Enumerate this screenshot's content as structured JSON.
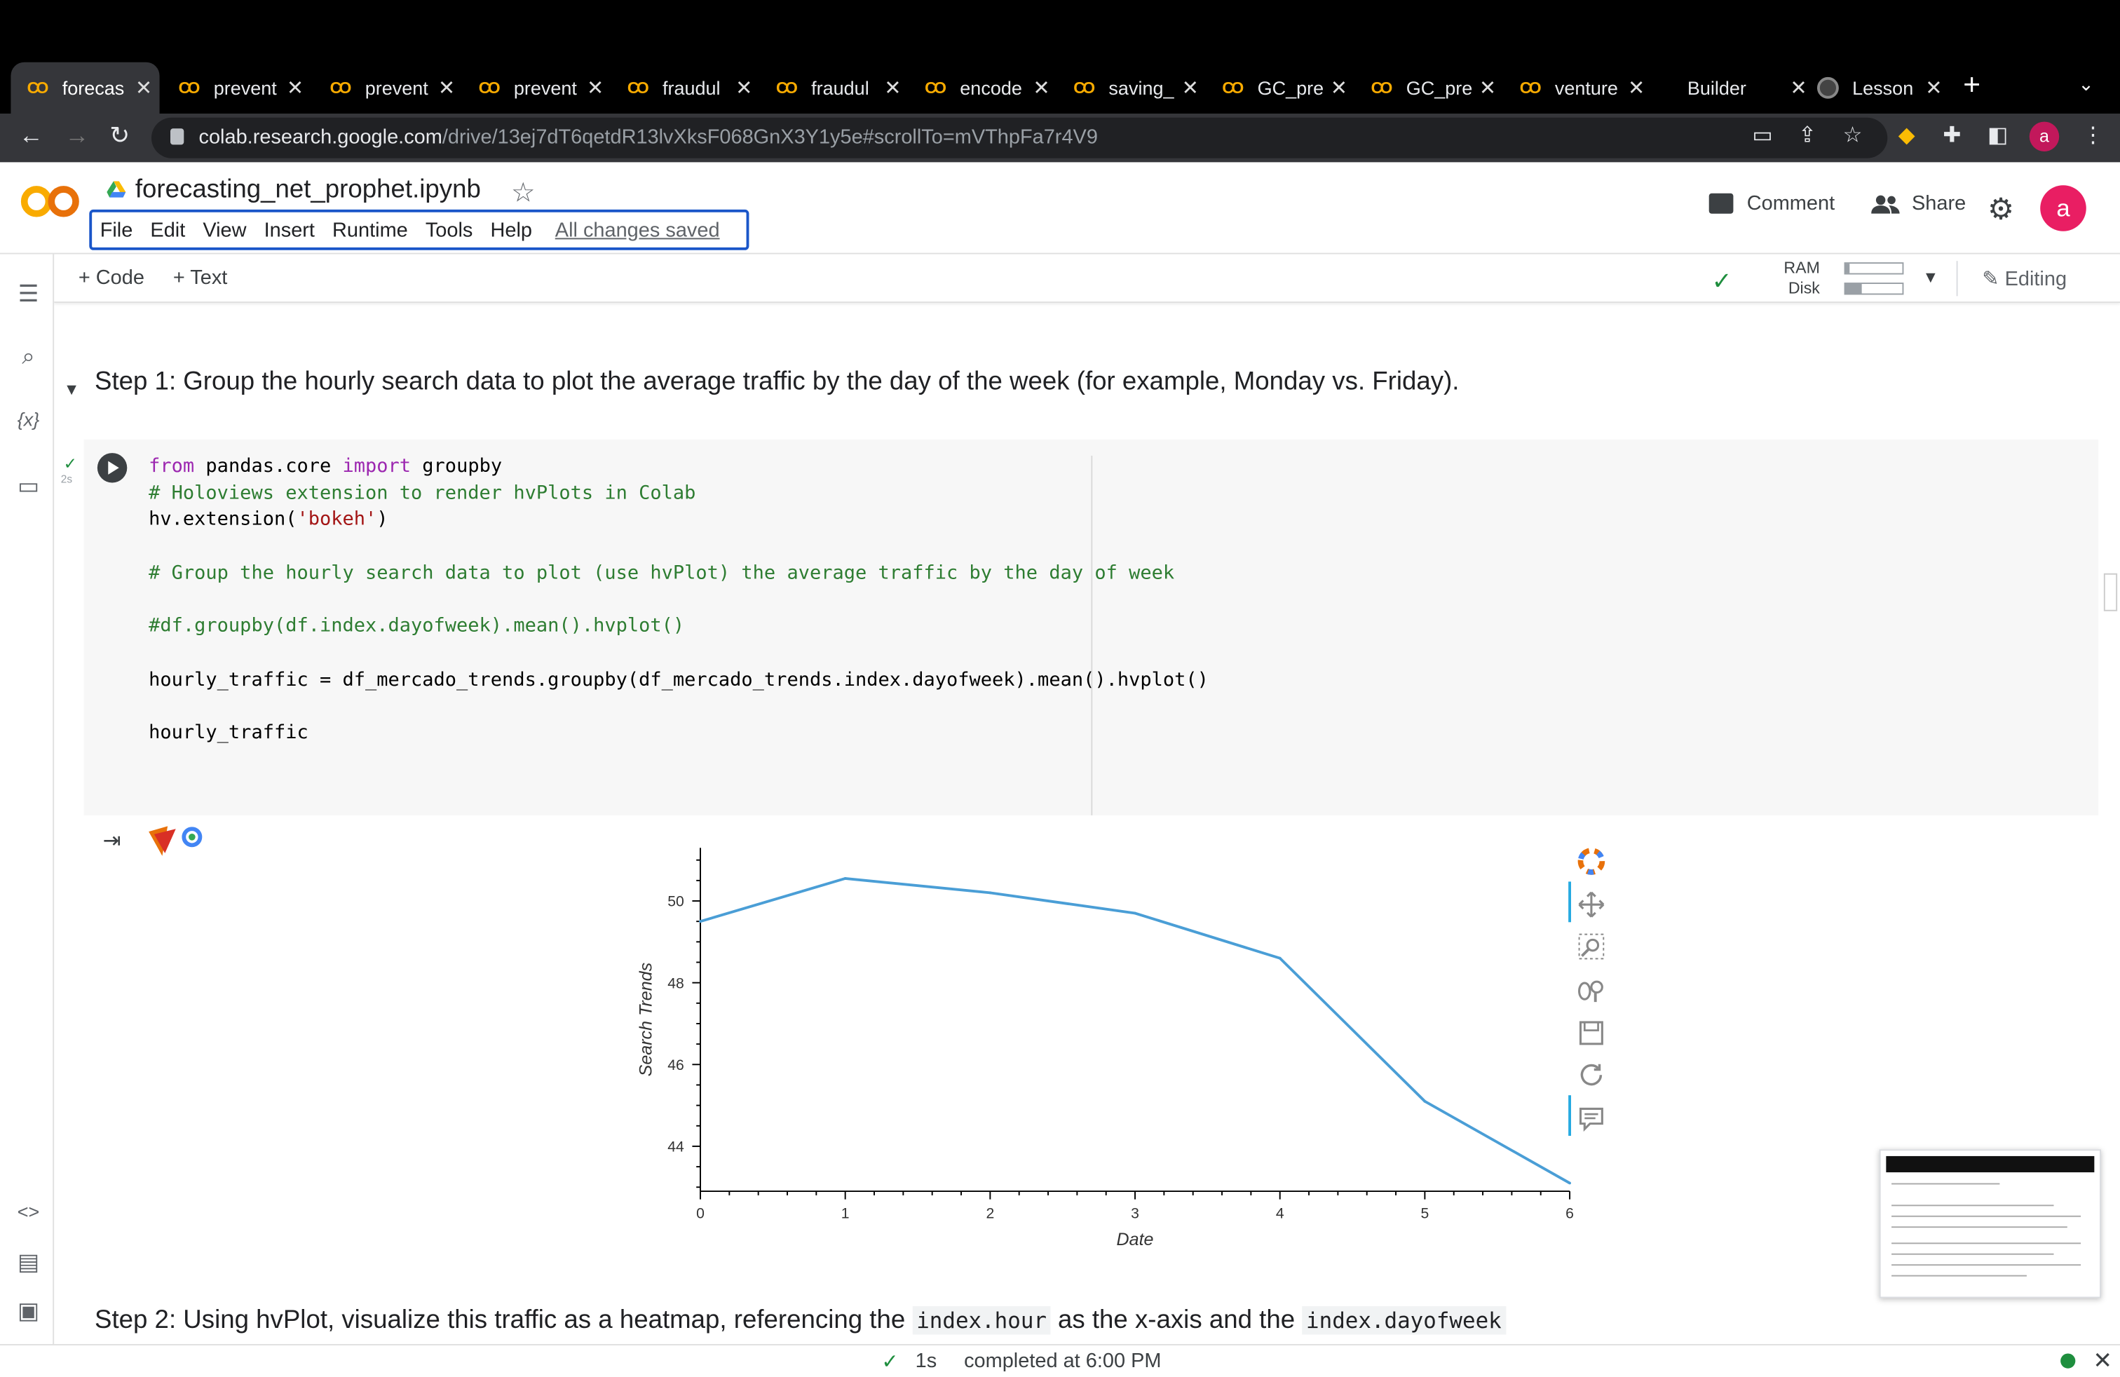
{
  "browser": {
    "tabs": [
      {
        "label": "forecas",
        "active": true,
        "icon": "colab-icon"
      },
      {
        "label": "prevent",
        "icon": "colab-icon"
      },
      {
        "label": "prevent",
        "icon": "colab-icon"
      },
      {
        "label": "prevent",
        "icon": "colab-icon"
      },
      {
        "label": "fraudul",
        "icon": "colab-icon"
      },
      {
        "label": "fraudul",
        "icon": "colab-icon"
      },
      {
        "label": "encode",
        "icon": "colab-icon"
      },
      {
        "label": "saving_",
        "icon": "colab-icon"
      },
      {
        "label": "GC_pre",
        "icon": "colab-icon"
      },
      {
        "label": "GC_pre",
        "icon": "colab-icon"
      },
      {
        "label": "venture",
        "icon": "colab-icon"
      },
      {
        "label": "Builder",
        "icon": "none"
      },
      {
        "label": "Lesson",
        "icon": "github-icon"
      }
    ],
    "url_host": "colab.research.google.com",
    "url_path": "/drive/13ej7dT6qetdR13lvXksF068GnX3Y1y5e#scrollTo=mVThpFa7r4V9",
    "profile_initial": "a"
  },
  "colab": {
    "notebook_title": "forecasting_net_prophet.ipynb",
    "menu": [
      "File",
      "Edit",
      "View",
      "Insert",
      "Runtime",
      "Tools",
      "Help"
    ],
    "save_status": "All changes saved",
    "comment_label": "Comment",
    "share_label": "Share",
    "user_initial": "a",
    "add_code_label": "+ Code",
    "add_text_label": "+ Text",
    "ram_label": "RAM",
    "disk_label": "Disk",
    "ram_fraction": 0.08,
    "disk_fraction": 0.28,
    "editing_label": "Editing"
  },
  "notebook": {
    "step1_heading": "Step 1: Group the hourly search data to plot the average traffic by the day of the week (for example, Monday vs. Friday).",
    "exec_time": "2s",
    "code_lines": [
      [
        {
          "t": "from",
          "c": "kw"
        },
        {
          "t": " pandas.core "
        },
        {
          "t": "import",
          "c": "kw"
        },
        {
          "t": " groupby"
        }
      ],
      [
        {
          "t": "# Holoviews extension to render hvPlots in Colab",
          "c": "cm"
        }
      ],
      [
        {
          "t": "hv.extension("
        },
        {
          "t": "'bokeh'",
          "c": "st"
        },
        {
          "t": ")"
        }
      ],
      [
        {
          "t": ""
        }
      ],
      [
        {
          "t": "# Group the hourly search data to plot (use hvPlot) the average traffic by the day of week",
          "c": "cm"
        }
      ],
      [
        {
          "t": ""
        }
      ],
      [
        {
          "t": "#df.groupby(df.index.dayofweek).mean().hvplot()",
          "c": "cm"
        }
      ],
      [
        {
          "t": ""
        }
      ],
      [
        {
          "t": "hourly_traffic = df_mercado_trends.groupby(df_mercado_trends.index.dayofweek).mean().hvplot()"
        }
      ],
      [
        {
          "t": ""
        }
      ],
      [
        {
          "t": "hourly_traffic"
        }
      ]
    ],
    "step2_parts": [
      {
        "t": "Step 2: Using hvPlot, visualize this traffic as a heatmap, referencing the "
      },
      {
        "t": "index.hour",
        "code": true
      },
      {
        "t": " as the x-axis and the "
      },
      {
        "t": "index.dayofweek",
        "code": true
      }
    ]
  },
  "chart_data": {
    "type": "line",
    "x": [
      0,
      1,
      2,
      3,
      4,
      5,
      6
    ],
    "series": [
      {
        "values": [
          49.5,
          50.55,
          50.2,
          49.7,
          48.6,
          45.1,
          43.1
        ],
        "color": "#4a9ed6"
      }
    ],
    "xlabel": "Date",
    "ylabel": "Search Trends",
    "xlim": [
      0,
      6
    ],
    "ylim": [
      42.9,
      51.3
    ],
    "x_ticks": [
      "0",
      "1",
      "2",
      "3",
      "4",
      "5",
      "6"
    ],
    "y_ticks": [
      44,
      46,
      48,
      50
    ],
    "grid": false
  },
  "status": {
    "duration": "1s",
    "message": "completed at 6:00 PM"
  }
}
